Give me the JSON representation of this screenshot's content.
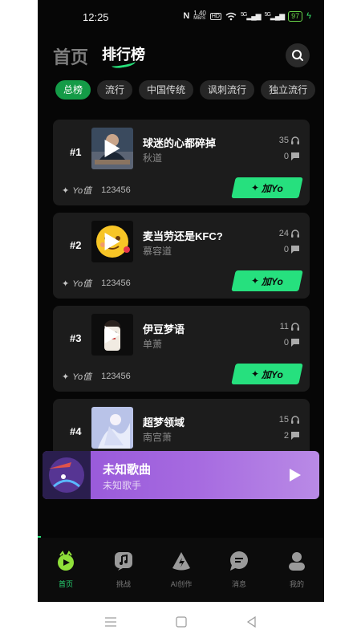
{
  "status_bar": {
    "time": "12:25",
    "nfc": "N",
    "speed": "1.40",
    "speed_unit": "MB/S",
    "hd": "HD",
    "sig1": "5G",
    "sig2": "5G",
    "battery": "97"
  },
  "header": {
    "tab_home": "首页",
    "tab_ranking": "排行榜"
  },
  "chips": [
    "总榜",
    "流行",
    "中国传统",
    "讽刺流行",
    "独立流行"
  ],
  "songs": [
    {
      "rank": "#1",
      "title": "球迷的心都碎掉",
      "artist": "秋道",
      "listens": "35",
      "comments": "0",
      "yo_label": "Yo值",
      "yo_value": "123456",
      "add_label": "加Yo"
    },
    {
      "rank": "#2",
      "title": "麦当劳还是KFC?",
      "artist": "慕容道",
      "listens": "24",
      "comments": "0",
      "yo_label": "Yo值",
      "yo_value": "123456",
      "add_label": "加Yo"
    },
    {
      "rank": "#3",
      "title": "伊豆梦语",
      "artist": "单萧",
      "listens": "11",
      "comments": "0",
      "yo_label": "Yo值",
      "yo_value": "123456",
      "add_label": "加Yo"
    },
    {
      "rank": "#4",
      "title": "超梦领域",
      "artist": "南宫萧",
      "listens": "15",
      "comments": "2"
    }
  ],
  "player": {
    "title": "未知歌曲",
    "artist": "未知歌手"
  },
  "nav": {
    "items": [
      {
        "label": "首页",
        "icon": "home-yo-icon"
      },
      {
        "label": "挑战",
        "icon": "music-challenge-icon"
      },
      {
        "label": "AI创作",
        "icon": "ai-create-icon"
      },
      {
        "label": "消息",
        "icon": "message-icon"
      },
      {
        "label": "我的",
        "icon": "profile-icon"
      }
    ]
  },
  "colors": {
    "accent": "#26e07e",
    "chip_active": "#149b47",
    "player_gradient_start": "#9454d8",
    "background": "#060606",
    "card": "#1c1c1c"
  }
}
